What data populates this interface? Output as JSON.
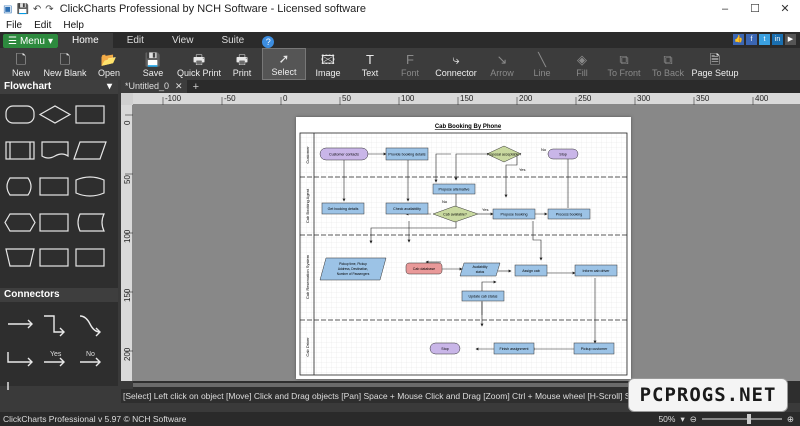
{
  "window": {
    "title": "ClickCharts Professional by NCH Software - Licensed software",
    "min": "–",
    "max": "☐",
    "close": "✕"
  },
  "menubar": {
    "items": [
      "File",
      "Edit",
      "Help"
    ]
  },
  "ribbon": {
    "menu_label": "Menu",
    "tabs": [
      "Home",
      "Edit",
      "View",
      "Suite"
    ],
    "active_tab": "Home",
    "help": "?",
    "social": [
      "👍",
      "f",
      "t",
      "in",
      "▶"
    ]
  },
  "toolbar": [
    {
      "label": "New",
      "icon": "new-icon",
      "glyph": "🗋",
      "dim": false
    },
    {
      "label": "New Blank",
      "icon": "new-blank-icon",
      "glyph": "🗋",
      "dim": false
    },
    {
      "label": "Open",
      "icon": "folder-icon",
      "glyph": "📂",
      "dim": false
    },
    {
      "label": "Save",
      "icon": "save-icon",
      "glyph": "💾",
      "dim": false
    },
    {
      "label": "Quick Print",
      "icon": "quick-print-icon",
      "glyph": "🖶",
      "dim": false
    },
    {
      "label": "Print",
      "icon": "print-icon",
      "glyph": "🖶",
      "dim": false
    },
    {
      "label": "Select",
      "icon": "cursor-icon",
      "glyph": "➚",
      "dim": false
    },
    {
      "label": "Image",
      "icon": "image-icon",
      "glyph": "🖾",
      "dim": false
    },
    {
      "label": "Text",
      "icon": "text-icon",
      "glyph": "T",
      "dim": false
    },
    {
      "label": "Font",
      "icon": "font-icon",
      "glyph": "F",
      "dim": true
    },
    {
      "label": "Connector",
      "icon": "connector-icon",
      "glyph": "⤷",
      "dim": false
    },
    {
      "label": "Arrow",
      "icon": "arrow-icon",
      "glyph": "↘",
      "dim": true
    },
    {
      "label": "Line",
      "icon": "line-icon",
      "glyph": "╲",
      "dim": true
    },
    {
      "label": "Fill",
      "icon": "fill-icon",
      "glyph": "◈",
      "dim": true
    },
    {
      "label": "To Front",
      "icon": "to-front-icon",
      "glyph": "⧉",
      "dim": true
    },
    {
      "label": "To Back",
      "icon": "to-back-icon",
      "glyph": "⧉",
      "dim": true
    },
    {
      "label": "Page Setup",
      "icon": "page-setup-icon",
      "glyph": "🗎",
      "dim": false
    }
  ],
  "left_panel": {
    "shapes_title": "Flowchart",
    "connectors_title": "Connectors",
    "connector_labels": {
      "yes": "Yes",
      "no": "No"
    }
  },
  "document": {
    "tab_label": "*Untitled_0",
    "tab_close": "✕",
    "add_tab": "+"
  },
  "rulers": {
    "h_ticks": [
      "-100",
      "-50",
      "0",
      "50",
      "100",
      "150",
      "200",
      "250",
      "300",
      "350",
      "400"
    ],
    "v_ticks": [
      "0",
      "50",
      "100",
      "150",
      "200"
    ]
  },
  "diagram": {
    "title": "Cab Booking By Phone",
    "lanes": [
      "Customer",
      "Cab Booking Agent",
      "Cab Reservation System",
      "Cab Driver"
    ],
    "nodes": {
      "customer_contacts": "Customer contacts",
      "provide_booking": "Provide booking details",
      "proposal_acceptable": "Proposal acceptable?",
      "stop": "Stop",
      "get_booking": "Get booking details",
      "check_availability": "Check availability",
      "propose_alternative": "Propose alternative",
      "cab_available": "Cab available?",
      "propose_booking": "Propose booking",
      "process_booking": "Process booking",
      "pickup_info": "Pickup time, Pickup Address, Destination, Number of Passengers",
      "cab_database": "Cab database",
      "availability_status": "Availability status",
      "assign_cab": "Assign cab",
      "inform_driver": "Inform cab driver",
      "update_status": "Update cab status",
      "stop2": "Stop",
      "finish_assignment": "Finish assignment",
      "pickup_customer": "Pickup customer"
    },
    "labels": {
      "yes": "Yes",
      "no": "No"
    }
  },
  "hint_bar": "[Select] Left click on object  [Move] Click and Drag objects  [Pan] Space + Mouse Click and Drag  [Zoom] Ctrl + Mouse wheel  [H-Scroll] Shift + Mouse wheel  [V-Scroll] Mouse",
  "status_bar": {
    "version": "ClickCharts Professional v 5.97 © NCH Software",
    "zoom": "50%",
    "zoom_fraction": 0.6
  },
  "watermark": "PCPROGS.NET",
  "colors": {
    "accent_green": "#2d8a3e",
    "node_blue": "#9cc3e6",
    "node_purple": "#c9b6e8",
    "node_red": "#e99999",
    "node_green": "#c9d9a0"
  }
}
